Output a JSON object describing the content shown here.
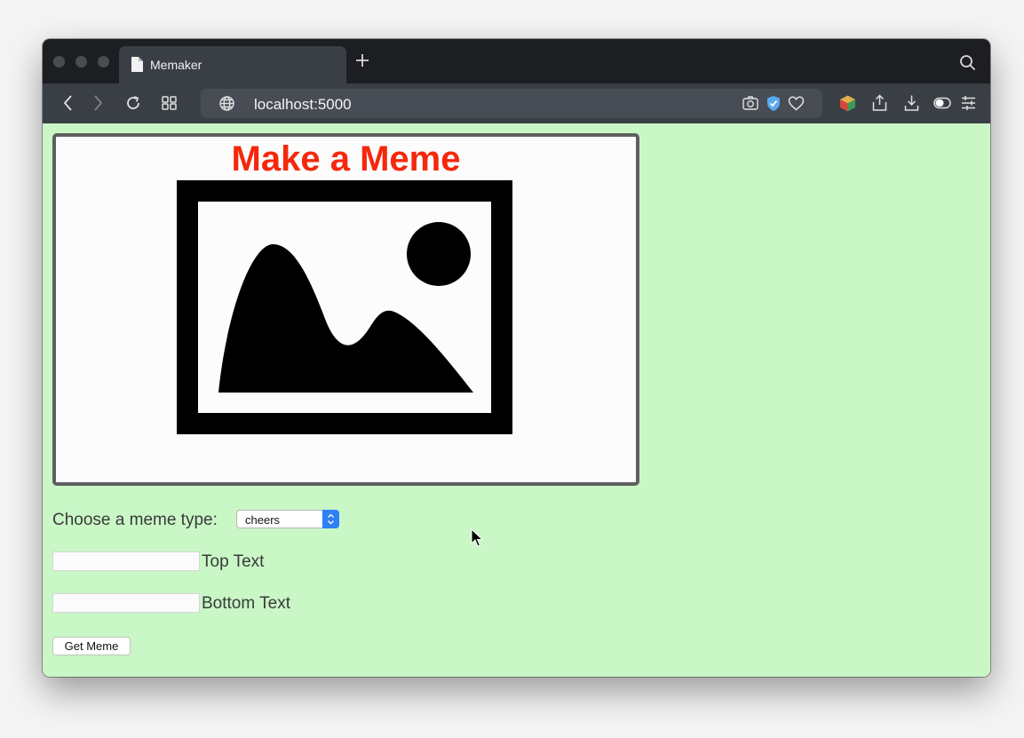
{
  "browser": {
    "tab_title": "Memaker",
    "url": "localhost:5000"
  },
  "page": {
    "meme_preview": {
      "title": "Make a Meme",
      "image_icon": "image-placeholder-icon",
      "title_color": "#f5280c"
    },
    "meme_type": {
      "label": "Choose a meme type:",
      "selected": "cheers"
    },
    "top_text": {
      "label": "Top Text",
      "value": ""
    },
    "bottom_text": {
      "label": "Bottom Text",
      "value": ""
    },
    "submit_label": "Get Meme"
  },
  "colors": {
    "page_background": "#c9f7c6",
    "chrome_dark": "#1c1e21",
    "toolbar": "#3a3f46",
    "select_accent": "#2f7ff5"
  }
}
